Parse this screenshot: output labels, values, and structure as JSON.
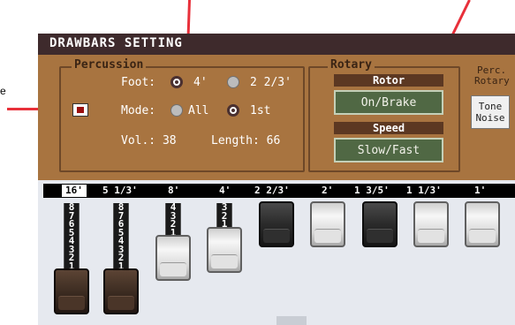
{
  "annotation": {
    "side_label": "e"
  },
  "window": {
    "title": "DRAWBARS SETTING"
  },
  "percussion": {
    "title": "Percussion",
    "foot_label": "Foot:",
    "foot_options": [
      {
        "label": "4'",
        "selected": true
      },
      {
        "label": "2 2/3'",
        "selected": false
      }
    ],
    "mode_label": "Mode:",
    "mode_options": [
      {
        "label": "All",
        "selected": false
      },
      {
        "label": "1st",
        "selected": true
      }
    ],
    "volume_text": "Vol.: 38",
    "length_text": "Length: 66"
  },
  "rotary": {
    "title": "Rotary",
    "rotor_header": "Rotor",
    "rotor_button": "On/Brake",
    "speed_header": "Speed",
    "speed_button": "Slow/Fast"
  },
  "perc_rotary": {
    "title_line1": "Perc.",
    "title_line2": "Rotary",
    "tone_line1": "Tone",
    "tone_line2": "Noise"
  },
  "drawbars": {
    "footages": [
      "16'",
      "5 1/3'",
      "8'",
      "4'",
      "2 2/3'",
      "2'",
      "1 3/5'",
      "1 1/3'",
      "1'"
    ],
    "selected_index": 0,
    "levels": [
      8,
      8,
      4,
      3,
      0,
      0,
      0,
      0,
      0
    ],
    "tick_labels": [
      "8",
      "7",
      "6",
      "5",
      "4",
      "3",
      "2",
      "1"
    ]
  }
}
